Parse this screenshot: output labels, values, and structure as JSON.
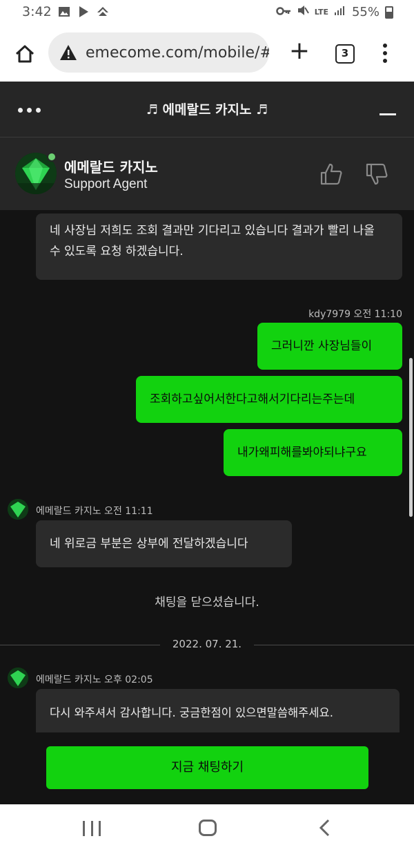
{
  "status_bar": {
    "time": "3:42",
    "battery": "55%",
    "network": "LTE"
  },
  "browser": {
    "url": "emecome.com/mobile/#",
    "tab_count": "3",
    "new_tab_label": "+"
  },
  "chat_header": {
    "title": "♬ 에메랄드 카지노 ♬",
    "agent_name": "에메랄드 카지노",
    "agent_role": "Support Agent"
  },
  "messages": {
    "m1_text": "네 사장님 저희도 조회 결과만 기다리고 있습니다 결과가 빨리 나올 수 있도록 요청 하겠습니다.",
    "user_meta": "kdy7979 오전 11:10",
    "user_msgs": [
      "그러니깐 사장님들이",
      "조회하고싶어서한다고해서기다리는주는데",
      "내가왜피해를봐야되냐구요"
    ],
    "agent_meta_1": "에메랄드 카지노 오전 11:11",
    "m2_text": "네 위로금 부분은 상부에 전달하겠습니다",
    "system_msg": "채팅을 닫으셨습니다.",
    "date_divider": "2022. 07. 21.",
    "agent_meta_2": "에메랄드 카지노 오후 02:05",
    "m3_text": "다시 와주셔서 감사합니다. 궁금한점이 있으면말씀해주세요."
  },
  "footer": {
    "start_chat_label": "지금 채팅하기"
  },
  "colors": {
    "accent_green": "#12d20f",
    "chat_bg": "#131313",
    "header_bg": "#262626",
    "agent_bubble": "#2b2b2b"
  },
  "icons": [
    "image-icon",
    "play-store-icon",
    "app-icon",
    "key-icon",
    "mute-icon",
    "signal-icon",
    "battery-icon",
    "home-icon",
    "warning-icon",
    "menu-dots-icon",
    "thumbs-up-icon",
    "thumbs-down-icon",
    "minimize-icon",
    "recent-apps-icon",
    "back-icon"
  ]
}
